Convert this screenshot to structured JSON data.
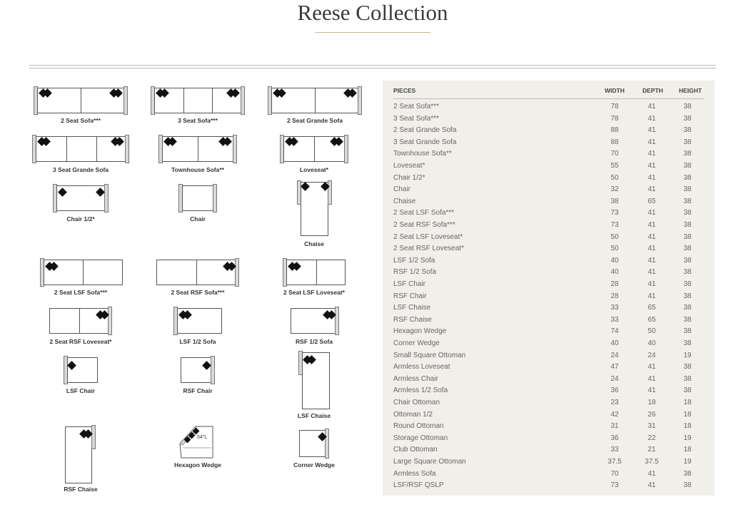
{
  "title": "Reese Collection",
  "colors": {
    "accent_rule": "#cdb88e",
    "panel_bg": "#f1efea"
  },
  "table": {
    "headers": {
      "pieces": "PIECES",
      "width": "WIDTH",
      "depth": "DEPTH",
      "height": "HEIGHT"
    },
    "rows": [
      {
        "name": "2 Seat Sofa***",
        "width": "78",
        "depth": "41",
        "height": "38"
      },
      {
        "name": "3 Seat Sofa***",
        "width": "78",
        "depth": "41",
        "height": "38"
      },
      {
        "name": "2 Seat Grande Sofa",
        "width": "88",
        "depth": "41",
        "height": "38"
      },
      {
        "name": "3 Seat Grande Sofa",
        "width": "88",
        "depth": "41",
        "height": "38"
      },
      {
        "name": "Townhouse Sofa**",
        "width": "70",
        "depth": "41",
        "height": "38"
      },
      {
        "name": "Loveseat*",
        "width": "55",
        "depth": "41",
        "height": "38"
      },
      {
        "name": "Chair 1/2*",
        "width": "50",
        "depth": "41",
        "height": "38"
      },
      {
        "name": "Chair",
        "width": "32",
        "depth": "41",
        "height": "38"
      },
      {
        "name": "Chaise",
        "width": "38",
        "depth": "65",
        "height": "38"
      },
      {
        "name": "2 Seat LSF Sofa***",
        "width": "73",
        "depth": "41",
        "height": "38"
      },
      {
        "name": "2 Seat RSF Sofa***",
        "width": "73",
        "depth": "41",
        "height": "38"
      },
      {
        "name": "2 Seat LSF Loveseat*",
        "width": "50",
        "depth": "41",
        "height": "38"
      },
      {
        "name": "2 Seat RSF Loveseat*",
        "width": "50",
        "depth": "41",
        "height": "38"
      },
      {
        "name": "LSF 1/2 Sofa",
        "width": "40",
        "depth": "41",
        "height": "38"
      },
      {
        "name": "RSF 1/2 Sofa",
        "width": "40",
        "depth": "41",
        "height": "38"
      },
      {
        "name": "LSF Chair",
        "width": "28",
        "depth": "41",
        "height": "38"
      },
      {
        "name": "RSF Chair",
        "width": "28",
        "depth": "41",
        "height": "38"
      },
      {
        "name": "LSF Chaise",
        "width": "33",
        "depth": "65",
        "height": "38"
      },
      {
        "name": "RSF Chaise",
        "width": "33",
        "depth": "65",
        "height": "38"
      },
      {
        "name": "Hexagon Wedge",
        "width": "74",
        "depth": "50",
        "height": "38"
      },
      {
        "name": "Corner Wedge",
        "width": "40",
        "depth": "40",
        "height": "38"
      },
      {
        "name": "Small Square Ottoman",
        "width": "24",
        "depth": "24",
        "height": "19"
      },
      {
        "name": "Armless Loveseat",
        "width": "47",
        "depth": "41",
        "height": "38"
      },
      {
        "name": "Armless Chair",
        "width": "24",
        "depth": "41",
        "height": "38"
      },
      {
        "name": "Armless 1/2 Sofa",
        "width": "36",
        "depth": "41",
        "height": "38"
      },
      {
        "name": "Chair Ottoman",
        "width": "23",
        "depth": "18",
        "height": "18"
      },
      {
        "name": "Ottoman 1/2",
        "width": "42",
        "depth": "26",
        "height": "18"
      },
      {
        "name": "Round Ottoman",
        "width": "31",
        "depth": "31",
        "height": "18"
      },
      {
        "name": "Storage Ottoman",
        "width": "36",
        "depth": "22",
        "height": "19"
      },
      {
        "name": "Club Ottoman",
        "width": "33",
        "depth": "21",
        "height": "18"
      },
      {
        "name": "Large Square Ottoman",
        "width": "37.5",
        "depth": "37.5",
        "height": "19"
      },
      {
        "name": "Armless Sofa",
        "width": "70",
        "depth": "41",
        "height": "38"
      },
      {
        "name": "LSF/RSF QSLP",
        "width": "73",
        "depth": "41",
        "height": "38"
      }
    ]
  },
  "diagrams": {
    "two_seat_sofa": "2 Seat Sofa***",
    "three_seat_sofa": "3 Seat Sofa***",
    "two_seat_grande_sofa": "2 Seat Grande Sofa",
    "three_seat_grande_sofa": "3 Seat Grande Sofa",
    "townhouse_sofa": "Townhouse Sofa**",
    "loveseat": "Loveseat*",
    "chair_half": "Chair 1/2*",
    "chair": "Chair",
    "chaise": "Chaise",
    "two_seat_lsf_sofa": "2 Seat LSF Sofa***",
    "two_seat_rsf_sofa": "2 Seat RSF Sofa***",
    "two_seat_lsf_loveseat": "2 Seat LSF Loveseat*",
    "two_seat_rsf_loveseat": "2 Seat RSF Loveseat*",
    "lsf_half_sofa": "LSF 1/2 Sofa",
    "rsf_half_sofa": "RSF 1/2 Sofa",
    "lsf_chair": "LSF Chair",
    "rsf_chair": "RSF Chair",
    "lsf_chaise": "LSF Chaise",
    "rsf_chaise": "RSF Chaise",
    "hexagon_wedge": "Hexagon Wedge",
    "hexagon_wedge_dim": "54\"L",
    "corner_wedge": "Corner Wedge"
  }
}
